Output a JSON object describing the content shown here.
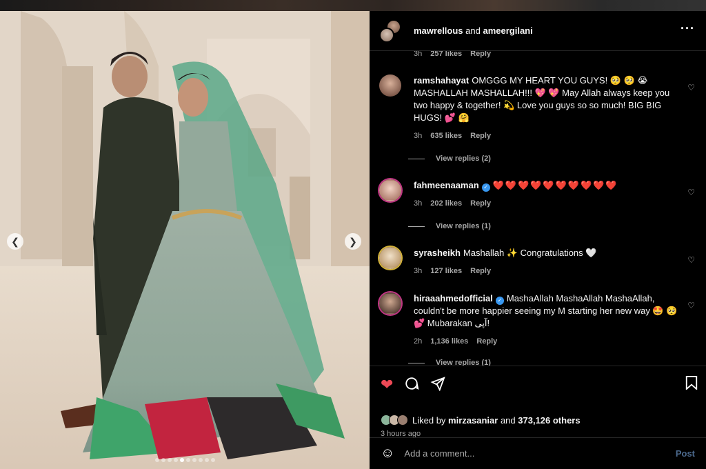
{
  "header": {
    "user1": "mawrellous",
    "and": "and",
    "user2": "ameergilani"
  },
  "first_meta": {
    "time": "3h",
    "likes": "257 likes",
    "reply": "Reply"
  },
  "comments": [
    {
      "user": "ramshahayat",
      "text": "OMGGG MY HEART YOU GUYS! 🥺 🥺 😭 MASHALLAH MASHALLAH!!! 💖 💖 May Allah always keep you two happy & together! 💫 Love you guys so so much! BIG BIG HUGS! 💕 🤗",
      "time": "3h",
      "likes": "635 likes",
      "reply": "Reply",
      "view_replies": "View replies (2)"
    },
    {
      "user": "fahmeenaaman",
      "text": "❤️❤️❤️❤️❤️❤️❤️❤️❤️❤️",
      "time": "3h",
      "likes": "202 likes",
      "reply": "Reply",
      "view_replies": "View replies (1)"
    },
    {
      "user": "syrasheikh",
      "text": "Mashallah ✨ Congratulations 🤍",
      "time": "3h",
      "likes": "127 likes",
      "reply": "Reply"
    },
    {
      "user": "hiraaahmedofficial",
      "text": "MashaAllah MashaAllah MashaAllah, couldn't be more happier seeing my M starting her new way 🤩 🥺 💕 Mubarakan آپی!",
      "time": "2h",
      "likes": "1,136 likes",
      "reply": "Reply",
      "view_replies": "View replies (1)"
    }
  ],
  "likes": {
    "prefix": "Liked by",
    "user": "mirzasaniar",
    "mid": "and",
    "count": "373,126 others"
  },
  "time_ago": "3 hours ago",
  "add_comment": {
    "placeholder": "Add a comment...",
    "post": "Post"
  },
  "icons": {
    "more": "more-horizontal-icon",
    "like": "heart-filled-icon",
    "comment": "comment-icon",
    "share": "send-icon",
    "save": "bookmark-icon",
    "emoji": "emoji-icon"
  },
  "colors": {
    "like_red": "#ed4956",
    "verified_blue": "#3897f0",
    "post_disabled": "#4c6a8e"
  },
  "carousel": {
    "count": 10,
    "active": 4
  }
}
